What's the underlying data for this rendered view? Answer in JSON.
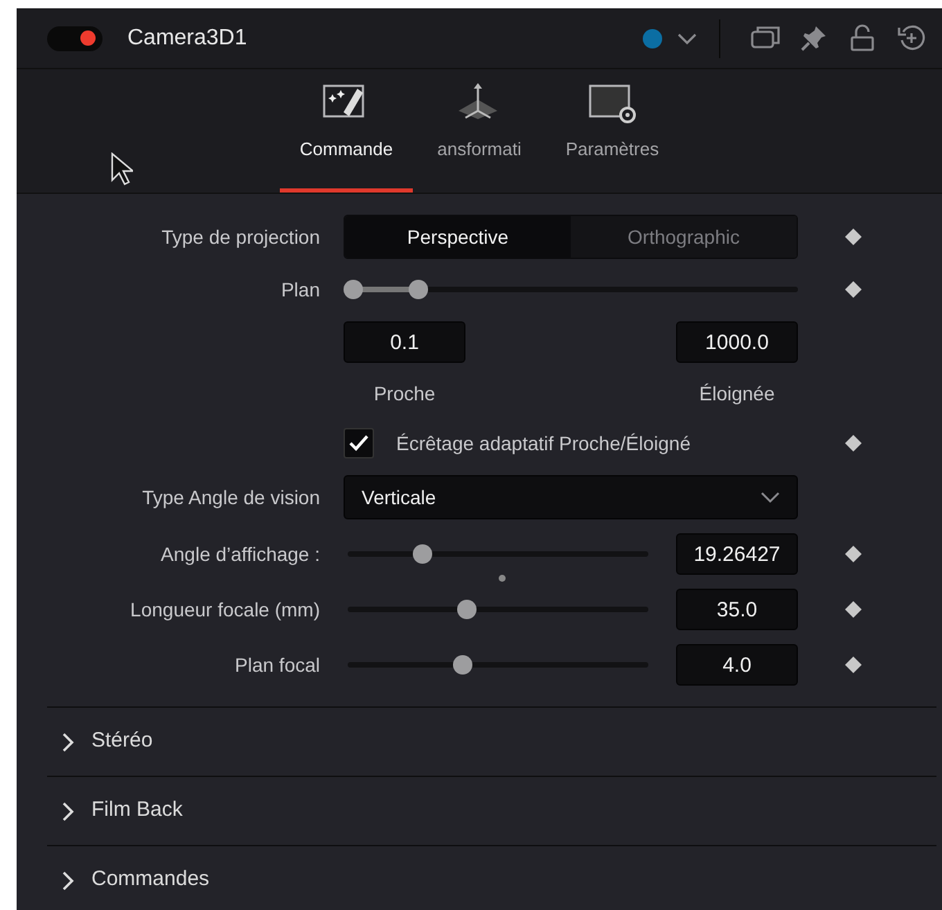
{
  "header": {
    "title": "Camera3D1",
    "enabled": true,
    "color": "#0b6ea3"
  },
  "tabs": [
    {
      "label": "Commande",
      "selected": true
    },
    {
      "label": "ansformati",
      "selected": false
    },
    {
      "label": "Paramètres",
      "selected": false
    }
  ],
  "controls": [
    {
      "kind": "segmented",
      "label": "Type de projection",
      "keyframe": true,
      "options": [
        {
          "label": "Perspective",
          "selected": true
        },
        {
          "label": "Orthographic",
          "selected": false
        }
      ]
    },
    {
      "kind": "range",
      "label": "Plan",
      "keyframe": true,
      "thumbs": [
        {
          "level": 0
        },
        {
          "level": 0.15
        }
      ]
    },
    {
      "kind": "pair",
      "fields": [
        {
          "value": "0.1",
          "caption": "Proche"
        },
        {
          "value": "1000.0",
          "caption": "Éloignée"
        }
      ]
    },
    {
      "kind": "checkbox",
      "label": "Écrêtage adaptatif Proche/Éloigné",
      "checked": true,
      "keyframe": true
    },
    {
      "kind": "dropdown",
      "label": "Type Angle de vision",
      "value": "Verticale"
    },
    {
      "kind": "slider",
      "label": "Angle d’affichage :",
      "level": 0.23,
      "value": "19.26427",
      "keyframe": true,
      "default_mark": true
    },
    {
      "kind": "slider",
      "label": "Longueur focale (mm)",
      "level": 0.39,
      "value": "35.0",
      "keyframe": true
    },
    {
      "kind": "slider",
      "label": "Plan focal",
      "level": 0.375,
      "value": "4.0",
      "keyframe": true
    }
  ],
  "sections": [
    {
      "label": "Stéréo",
      "expanded": false
    },
    {
      "label": "Film Back",
      "expanded": false
    },
    {
      "label": "Commandes",
      "expanded": false
    }
  ]
}
